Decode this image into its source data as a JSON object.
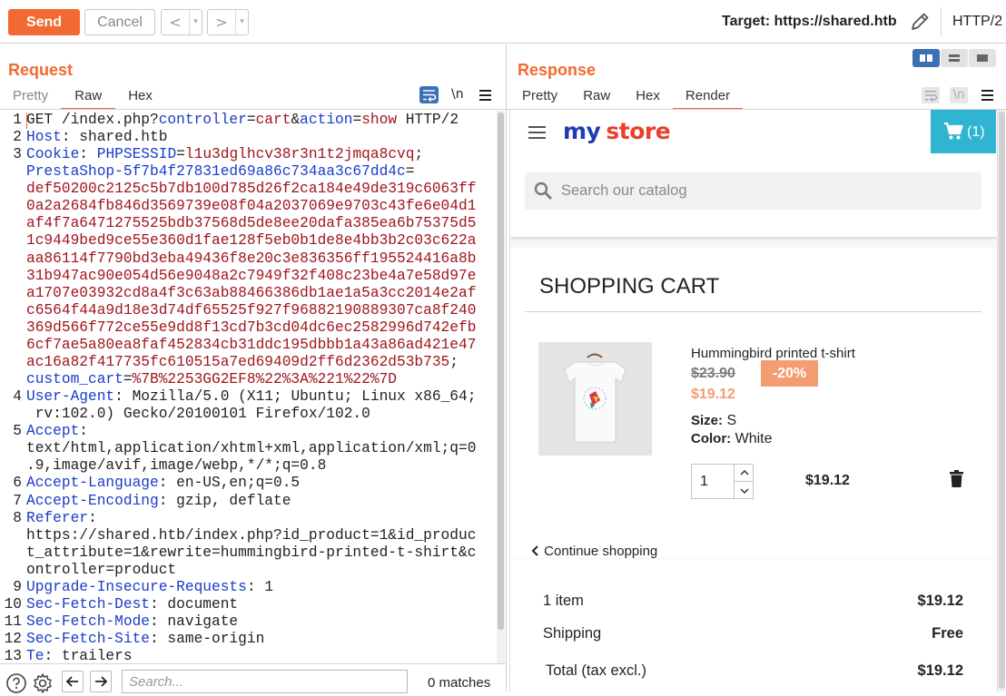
{
  "toolbar": {
    "send_label": "Send",
    "cancel_label": "Cancel",
    "back_glyph": "<",
    "forward_glyph": ">",
    "dropdown_glyph": "▾",
    "target_text": "Target: https://shared.htb",
    "http_version": "HTTP/2"
  },
  "request": {
    "title": "Request",
    "tabs": [
      "Pretty",
      "Raw",
      "Hex"
    ],
    "active_tab": "Raw",
    "newline_toggle": "\\n",
    "lines": [
      {
        "n": "1",
        "parts": [
          [
            "t",
            "GET /index.php?"
          ],
          [
            "k",
            "controller"
          ],
          [
            "t",
            "="
          ],
          [
            "v",
            "cart"
          ],
          [
            "t",
            "&"
          ],
          [
            "k",
            "action"
          ],
          [
            "t",
            "="
          ],
          [
            "v",
            "show"
          ],
          [
            "t",
            " HTTP/2"
          ]
        ]
      },
      {
        "n": "2",
        "parts": [
          [
            "k",
            "Host"
          ],
          [
            "t",
            ": shared.htb"
          ]
        ]
      },
      {
        "n": "3",
        "parts": [
          [
            "k",
            "Cookie"
          ],
          [
            "t",
            ": "
          ],
          [
            "k",
            "PHPSESSID"
          ],
          [
            "t",
            "="
          ],
          [
            "v",
            "l1u3dglhcv38r3n1t2jmqa8cvq"
          ],
          [
            "t",
            ";"
          ]
        ]
      },
      {
        "n": "",
        "parts": [
          [
            "k",
            "PrestaShop-5f7b4f27831ed69a86c734aa3c67dd4c"
          ],
          [
            "t",
            "="
          ]
        ]
      },
      {
        "n": "",
        "parts": [
          [
            "v",
            "def50200c2125c5b7db100d785d26f2ca184e49de319c6063ff"
          ]
        ]
      },
      {
        "n": "",
        "parts": [
          [
            "v",
            "0a2a2684fb846d3569739e08f04a2037069e9703c43fe6e04d1"
          ]
        ]
      },
      {
        "n": "",
        "parts": [
          [
            "v",
            "af4f7a6471275525bdb37568d5de8ee20dafa385ea6b75375d5"
          ]
        ]
      },
      {
        "n": "",
        "parts": [
          [
            "v",
            "1c9449bed9ce55e360d1fae128f5eb0b1de8e4bb3b2c03c622a"
          ]
        ]
      },
      {
        "n": "",
        "parts": [
          [
            "v",
            "aa86114f7790bd3eba49436f8e20c3e836356ff195524416a8b"
          ]
        ]
      },
      {
        "n": "",
        "parts": [
          [
            "v",
            "31b947ac90e054d56e9048a2c7949f32f408c23be4a7e58d97e"
          ]
        ]
      },
      {
        "n": "",
        "parts": [
          [
            "v",
            "a1707e03932cd8a4f3c63ab88466386db1ae1a5a3cc2014e2af"
          ]
        ]
      },
      {
        "n": "",
        "parts": [
          [
            "v",
            "c6564f44a9d18e3d74df65525f927f96882190889307ca8f240"
          ]
        ]
      },
      {
        "n": "",
        "parts": [
          [
            "v",
            "369d566f772ce55e9dd8f13cd7b3cd04dc6ec2582996d742efb"
          ]
        ]
      },
      {
        "n": "",
        "parts": [
          [
            "v",
            "6cf7ae5a80ea8faf452834cb31ddc195dbbb1a43a86ad421e47"
          ]
        ]
      },
      {
        "n": "",
        "parts": [
          [
            "v",
            "ac16a82f417735fc610515a7ed69409d2ff6d2362d53b735"
          ],
          [
            "t",
            ";"
          ]
        ]
      },
      {
        "n": "",
        "parts": [
          [
            "k",
            "custom_cart"
          ],
          [
            "t",
            "="
          ],
          [
            "v",
            "%7B%2253GG2EF8%22%3A%221%22%7D"
          ]
        ]
      },
      {
        "n": "4",
        "parts": [
          [
            "k",
            "User-Agent"
          ],
          [
            "t",
            ": Mozilla/5.0 (X11; Ubuntu; Linux x86_64;"
          ]
        ]
      },
      {
        "n": "",
        "parts": [
          [
            "t",
            " rv:102.0) Gecko/20100101 Firefox/102.0"
          ]
        ]
      },
      {
        "n": "5",
        "parts": [
          [
            "k",
            "Accept"
          ],
          [
            "t",
            ":"
          ]
        ]
      },
      {
        "n": "",
        "parts": [
          [
            "t",
            "text/html,application/xhtml+xml,application/xml;q=0"
          ]
        ]
      },
      {
        "n": "",
        "parts": [
          [
            "t",
            ".9,image/avif,image/webp,*/*;q=0.8"
          ]
        ]
      },
      {
        "n": "6",
        "parts": [
          [
            "k",
            "Accept-Language"
          ],
          [
            "t",
            ": en-US,en;q=0.5"
          ]
        ]
      },
      {
        "n": "7",
        "parts": [
          [
            "k",
            "Accept-Encoding"
          ],
          [
            "t",
            ": gzip, deflate"
          ]
        ]
      },
      {
        "n": "8",
        "parts": [
          [
            "k",
            "Referer"
          ],
          [
            "t",
            ":"
          ]
        ]
      },
      {
        "n": "",
        "parts": [
          [
            "t",
            "https://shared.htb/index.php?id_product=1&id_produc"
          ]
        ]
      },
      {
        "n": "",
        "parts": [
          [
            "t",
            "t_attribute=1&rewrite=hummingbird-printed-t-shirt&c"
          ]
        ]
      },
      {
        "n": "",
        "parts": [
          [
            "t",
            "ontroller=product"
          ]
        ]
      },
      {
        "n": "9",
        "parts": [
          [
            "k",
            "Upgrade-Insecure-Requests"
          ],
          [
            "t",
            ": 1"
          ]
        ]
      },
      {
        "n": "10",
        "parts": [
          [
            "k",
            "Sec-Fetch-Dest"
          ],
          [
            "t",
            ": document"
          ]
        ]
      },
      {
        "n": "11",
        "parts": [
          [
            "k",
            "Sec-Fetch-Mode"
          ],
          [
            "t",
            ": navigate"
          ]
        ]
      },
      {
        "n": "12",
        "parts": [
          [
            "k",
            "Sec-Fetch-Site"
          ],
          [
            "t",
            ": same-origin"
          ]
        ]
      },
      {
        "n": "13",
        "parts": [
          [
            "k",
            "Te"
          ],
          [
            "t",
            ": trailers"
          ]
        ]
      }
    ]
  },
  "search": {
    "placeholder": "Search...",
    "matches": "0 matches"
  },
  "response": {
    "title": "Response",
    "tabs": [
      "Pretty",
      "Raw",
      "Hex",
      "Render"
    ],
    "active_tab": "Render",
    "newline_toggle": "\\n"
  },
  "store": {
    "logo_my": "my",
    "logo_store": "store",
    "cart_count": "(1)",
    "search_placeholder": "Search our catalog",
    "heading": "SHOPPING CART",
    "product": {
      "name": "Hummingbird printed t-shirt",
      "old_price": "$23.90",
      "discount": "-20%",
      "price": "$19.12",
      "size_label": "Size:",
      "size_value": "S",
      "color_label": "Color:",
      "color_value": "White",
      "quantity": "1",
      "line_total": "$19.12"
    },
    "continue_label": "Continue shopping",
    "summary": {
      "items_label": "1 item",
      "items_value": "$19.12",
      "shipping_label": "Shipping",
      "shipping_value": "Free",
      "total_label": "Total (tax excl.)",
      "total_value": "$19.12"
    }
  },
  "colors": {
    "accent": "#f26a32",
    "header_key": "#1a3cc8",
    "value": "#a1151e",
    "cart_blue": "#2fb5d2",
    "discount_bg": "#f39d72",
    "price_orange": "#f39d72",
    "layout_active": "#3d6fb4"
  },
  "icons": [
    "pencil-icon",
    "wrap-icon",
    "hamburger-menu-icon",
    "cart-icon",
    "search-icon",
    "trash-icon",
    "help-icon",
    "gear-icon",
    "arrow-left-icon",
    "arrow-right-icon"
  ]
}
